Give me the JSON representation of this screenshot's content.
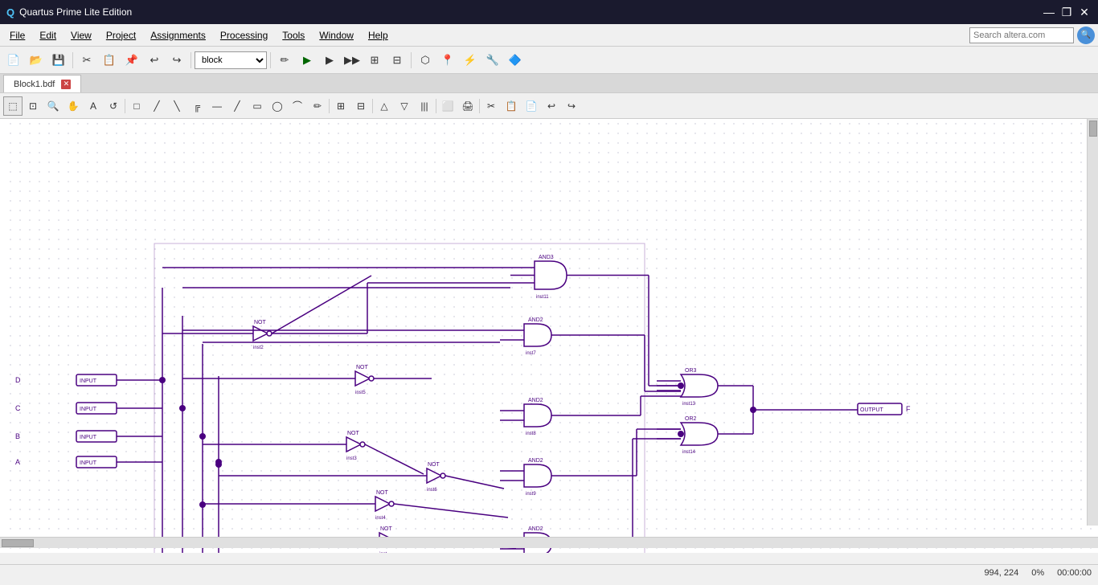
{
  "titleBar": {
    "title": "Quartus Prime Lite Edition",
    "icon": "Q",
    "controls": {
      "minimize": "—",
      "restore": "❐",
      "close": "✕"
    }
  },
  "menuBar": {
    "items": [
      {
        "label": "File",
        "id": "file"
      },
      {
        "label": "Edit",
        "id": "edit"
      },
      {
        "label": "View",
        "id": "view"
      },
      {
        "label": "Project",
        "id": "project"
      },
      {
        "label": "Assignments",
        "id": "assignments"
      },
      {
        "label": "Processing",
        "id": "processing"
      },
      {
        "label": "Tools",
        "id": "tools"
      },
      {
        "label": "Window",
        "id": "window"
      },
      {
        "label": "Help",
        "id": "help"
      }
    ],
    "search": {
      "placeholder": "Search altera.com",
      "value": ""
    }
  },
  "toolbar": {
    "blockSelector": {
      "value": "block",
      "options": [
        "block"
      ]
    }
  },
  "tab": {
    "label": "Block1.bdf",
    "active": true
  },
  "statusBar": {
    "coordinates": "994, 224",
    "zoom": "0%",
    "time": "00:00:00"
  }
}
